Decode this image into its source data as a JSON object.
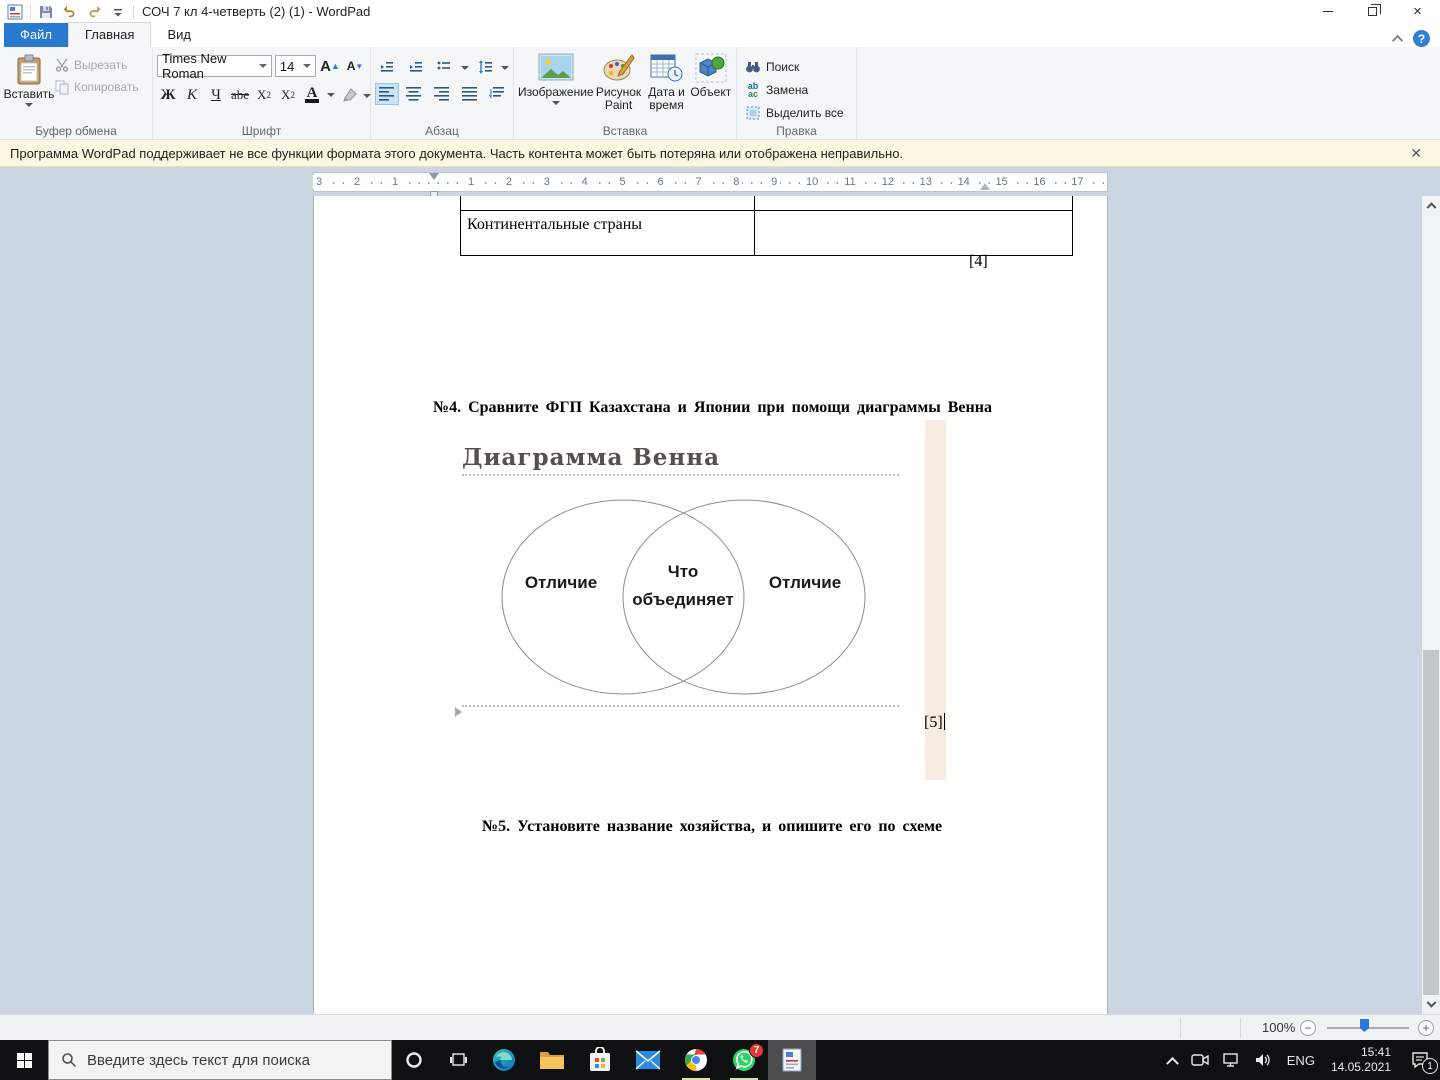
{
  "window": {
    "title": "СОЧ 7 кл 4-четверть (2) (1) - WordPad"
  },
  "tabs": {
    "file": "Файл",
    "home": "Главная",
    "view": "Вид"
  },
  "ribbon": {
    "clipboard": {
      "group_label": "Буфер обмена",
      "paste": "Вставить",
      "cut": "Вырезать",
      "copy": "Копировать"
    },
    "font": {
      "group_label": "Шрифт",
      "family": "Times New Roman",
      "size": "14",
      "bold": "Ж",
      "italic": "К",
      "underline": "Ч",
      "strikethrough": "abe",
      "sub_base": "X",
      "sub_small": "2",
      "sup_base": "X",
      "sup_small": "2",
      "color_letter": "A",
      "grow": "A",
      "shrink": "A"
    },
    "paragraph": {
      "group_label": "Абзац"
    },
    "insert": {
      "group_label": "Вставка",
      "image": "Изображение",
      "paint_line1": "Рисунок",
      "paint_line2": "Paint",
      "date_line1": "Дата и",
      "date_line2": "время",
      "object": "Объект"
    },
    "editing": {
      "group_label": "Правка",
      "find": "Поиск",
      "replace": "Замена",
      "select_all": "Выделить все",
      "replace_ab": "ab",
      "replace_ac": "ac"
    }
  },
  "warning": {
    "text": "Программа WordPad поддерживает не все функции формата этого документа. Часть контента может быть потеряна или отображена неправильно.",
    "close": "✕"
  },
  "ruler": {
    "left_numbers": [
      "3",
      "2",
      "1"
    ],
    "right_numbers": [
      "1",
      "2",
      "3",
      "4",
      "5",
      "6",
      "7",
      "8",
      "9",
      "10",
      "11",
      "12",
      "13",
      "14",
      "15",
      "16",
      "17"
    ]
  },
  "document": {
    "table_cell": "Континентальные страны",
    "score4": "[4]",
    "question4": "№4. Сравните ФГП Казахстана и Японии при помощи диаграммы Венна",
    "venn_title": "Диаграмма Венна",
    "venn_left": "Отличие",
    "venn_center_line1": "Что",
    "venn_center_line2": "объединяет",
    "venn_right": "Отличие",
    "score5": "[5]",
    "question5": "№5. Установите название хозяйства, и опишите его по схеме"
  },
  "statusbar": {
    "zoom": "100%"
  },
  "taskbar": {
    "search_placeholder": "Введите здесь текст для поиска",
    "language": "ENG",
    "time": "15:41",
    "date": "14.05.2021",
    "whatsapp_badge": "7",
    "notification_badge": "1"
  }
}
